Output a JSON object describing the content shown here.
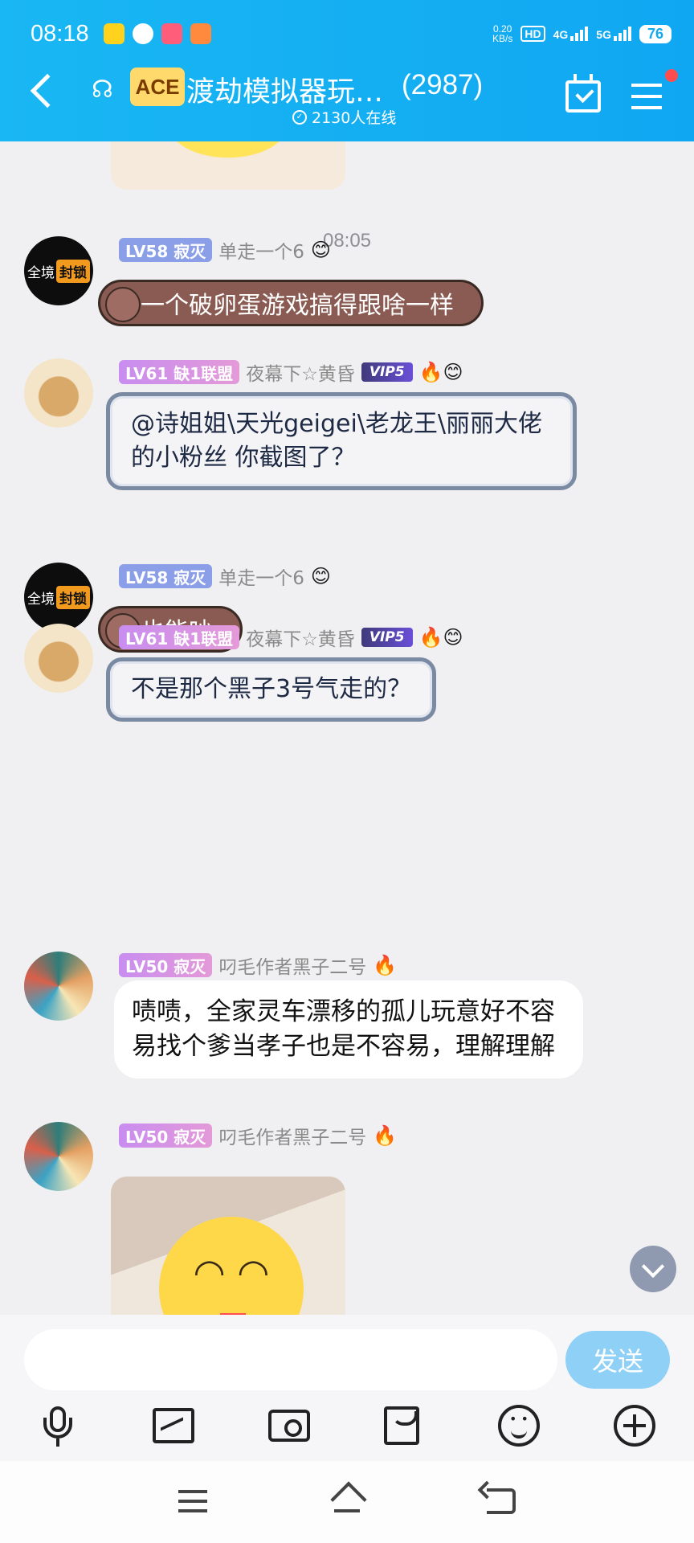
{
  "status_bar": {
    "time": "08:18",
    "net_speed_value": "0.20",
    "net_speed_unit": "KB/s",
    "hd_label": "HD",
    "signal1_label": "4G",
    "signal2_label": "5G",
    "battery": "76",
    "notification_icons": [
      "meituan-icon",
      "compass-icon",
      "app-icon",
      "game-icon"
    ]
  },
  "header": {
    "group_logo_text": "ACE",
    "group_name": "渡劫模拟器玩…",
    "member_count": "(2987)",
    "online_text": "2130人在线",
    "accent_color": "#13aaf0"
  },
  "chat": {
    "timestamp": "08:05",
    "messages": [
      {
        "avatar_text": "全境",
        "avatar_tag": "封锁",
        "level": "LV58 寂灭",
        "nickname": "单走一个6",
        "badge_emoji": "😊",
        "text": "一个破卵蛋游戏搞得跟啥一样"
      },
      {
        "level": "LV61 缺1联盟",
        "nickname": "夜幕下☆黄昏",
        "vip": "VIP5",
        "badge_emoji": "🔥😊",
        "text": "@诗姐姐\\天光geigei\\老龙王\\丽丽大佬的小粉丝 你截图了？"
      },
      {
        "avatar_text": "全境",
        "avatar_tag": "封锁",
        "level": "LV58 寂灭",
        "nickname": "单走一个6",
        "badge_emoji": "😊",
        "text": "也能吵"
      },
      {
        "level": "LV61 缺1联盟",
        "nickname": "夜幕下☆黄昏",
        "vip": "VIP5",
        "badge_emoji": "🔥😊",
        "text": "不是那个黑子3号气走的？"
      },
      {
        "level": "LV50 寂灭",
        "nickname": "叼毛作者黑子二号",
        "badge_emoji": "🔥",
        "text": "啧啧，全家灵车漂移的孤儿玩意好不容易找个爹当孝子也是不容易，理解理解"
      },
      {
        "level": "LV50 寂灭",
        "nickname": "叼毛作者黑子二号",
        "badge_emoji": "🔥",
        "text": ""
      }
    ]
  },
  "composer": {
    "input_value": "",
    "send_label": "发送",
    "tools": [
      "microphone-icon",
      "image-icon",
      "camera-icon",
      "red-packet-icon",
      "emoji-icon",
      "plus-icon"
    ]
  },
  "nav": {
    "items": [
      "menu-icon",
      "home-icon",
      "back-icon"
    ]
  }
}
